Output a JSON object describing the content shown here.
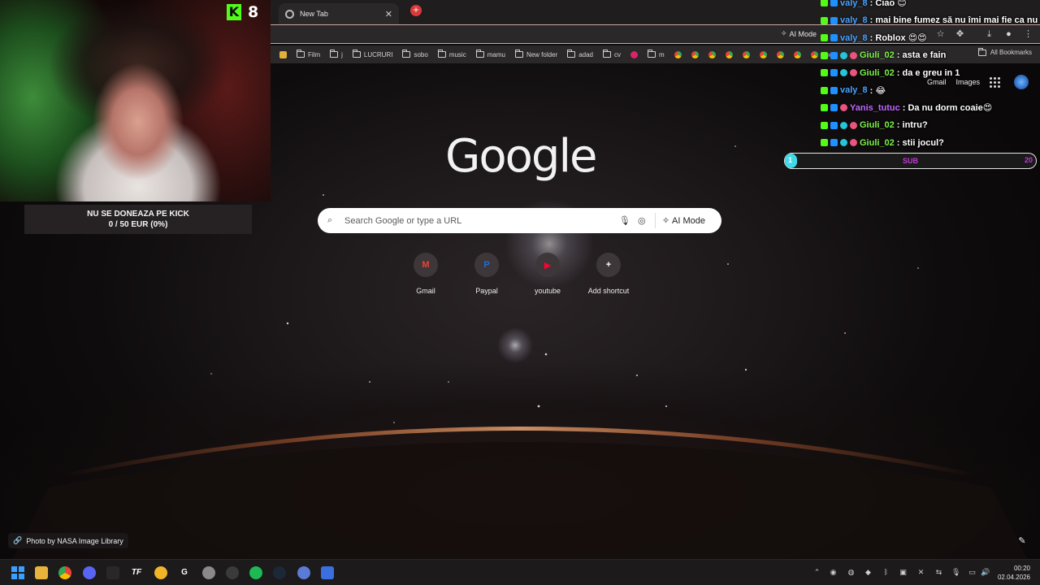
{
  "browser": {
    "tab_title": "New Tab",
    "omnibar_ai_mode": "AI Mode",
    "bookmarks": [
      "Film",
      "j",
      "LUCRURI",
      "sobo",
      "music",
      "mamu",
      "New folder",
      "adad",
      "cv",
      "m"
    ],
    "bookmarks_overflow": "»",
    "all_bookmarks": "All Bookmarks"
  },
  "ntp": {
    "header_links": [
      "Gmail",
      "Images"
    ],
    "logo_text": "Google",
    "search_placeholder": "Search Google or type a URL",
    "ai_mode_label": "AI Mode",
    "shortcuts": [
      {
        "label": "Gmail",
        "glyph": "M",
        "color": "#ea4335"
      },
      {
        "label": "Paypal",
        "glyph": "P",
        "color": "#1d6fd6"
      },
      {
        "label": "youtube",
        "glyph": "▶",
        "color": "#ff0033"
      },
      {
        "label": "Add shortcut",
        "glyph": "+",
        "color": "#ffffff"
      }
    ],
    "photo_credit": "Photo by NASA Image Library"
  },
  "stream": {
    "viewer_count": "8",
    "kick_logo_text": "K",
    "donation_title": "NU SE DONEAZA PE KICK",
    "donation_progress": "0 / 50 EUR (0%)",
    "sub_goal": {
      "label": "SUB",
      "current": "1",
      "goal": "20",
      "fraction": 0.03
    }
  },
  "chat": [
    {
      "user": "valy_8",
      "color": "#4aa3ff",
      "text": ": Ciao 😊",
      "badges": [
        "kick",
        "blue"
      ]
    },
    {
      "user": "valy_8",
      "color": "#4aa3ff",
      "text": ": mai bine fumez să nu îmi mai fie ca nu",
      "badges": [
        "kick",
        "blue"
      ]
    },
    {
      "user": "valy_8",
      "color": "#4aa3ff",
      "text": ": Roblox 😍😍",
      "badges": [
        "kick",
        "blue"
      ]
    },
    {
      "user": "Giuli_02",
      "color": "#7cf24a",
      "text": ": asta e fain",
      "badges": [
        "kick",
        "blue",
        "cyan",
        "pink"
      ]
    },
    {
      "user": "Giuli_02",
      "color": "#7cf24a",
      "text": ": da e greu in 1",
      "badges": [
        "kick",
        "blue",
        "cyan",
        "pink"
      ]
    },
    {
      "user": "valy_8",
      "color": "#4aa3ff",
      "text": ": 😂",
      "badges": [
        "kick",
        "blue"
      ]
    },
    {
      "user": "Yanis_tutuc",
      "color": "#c067ff",
      "text": ": Da nu dorm coaie😍",
      "badges": [
        "kick",
        "blue",
        "pink"
      ]
    },
    {
      "user": "Giuli_02",
      "color": "#7cf24a",
      "text": ": intru?",
      "badges": [
        "kick",
        "blue",
        "cyan",
        "pink"
      ]
    },
    {
      "user": "Giuli_02",
      "color": "#7cf24a",
      "text": ": stii jocul?",
      "badges": [
        "kick",
        "blue",
        "cyan",
        "pink"
      ]
    }
  ],
  "taskbar": {
    "apps": [
      "windows-start",
      "file-explorer",
      "chrome",
      "discord",
      "app-blank",
      "tf-app",
      "coin-app",
      "google-g",
      "avatar-app",
      "dark-app",
      "spotify",
      "steam",
      "network-app",
      "blue-app"
    ],
    "clock_time": "00:20",
    "clock_date": "02.04.2026"
  },
  "colors": {
    "kick_green": "#53fc18",
    "sub_cyan": "#41d8e8",
    "sub_magenta": "#c03bd6"
  }
}
